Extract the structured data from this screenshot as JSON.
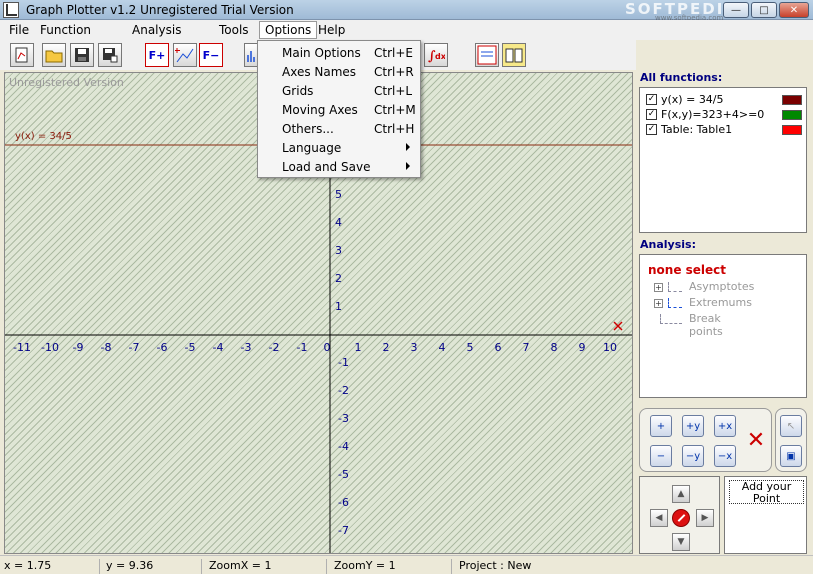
{
  "window": {
    "title": "Graph Plotter v1.2  Unregistered Trial Version",
    "watermark": "SOFTPEDIA",
    "watermark_url": "www.softpedia.com",
    "min_glyph": "—",
    "max_glyph": "□",
    "close_glyph": "✕"
  },
  "menubar": {
    "items": [
      "File",
      "Function",
      "Analysis",
      "Tools",
      "Options",
      "Help"
    ]
  },
  "toolbar": {
    "buttons": [
      "new-graph",
      "open",
      "save",
      "save-as",
      "F+",
      "add-point-function",
      "F−",
      "derivative",
      "integral",
      "step-by-step-solution",
      "help-book"
    ]
  },
  "options_menu": {
    "items": [
      {
        "label": "Main Options",
        "shortcut": "Ctrl+E"
      },
      {
        "label": "Axes Names",
        "shortcut": "Ctrl+R"
      },
      {
        "label": "Grids",
        "shortcut": "Ctrl+L"
      },
      {
        "label": "Moving Axes",
        "shortcut": "Ctrl+M"
      },
      {
        "label": "Others...",
        "shortcut": "Ctrl+H"
      },
      {
        "label": "Language",
        "submenu": true
      },
      {
        "label": "Load and Save",
        "submenu": true
      }
    ]
  },
  "graph": {
    "unregistered": "Unregistered Version",
    "function_label": "y(x) = 34/5",
    "x_ticks": [
      "-11",
      "-10",
      "-9",
      "-8",
      "-7",
      "-6",
      "-5",
      "-4",
      "-3",
      "-2",
      "-1",
      "0",
      "1",
      "2",
      "3",
      "4",
      "5",
      "6",
      "7",
      "8",
      "9",
      "10"
    ],
    "y_ticks": [
      "5",
      "4",
      "3",
      "2",
      "1",
      "-1",
      "-2",
      "-3",
      "-4",
      "-5",
      "-6",
      "-7"
    ]
  },
  "functions_panel": {
    "title": "All functions:",
    "items": [
      {
        "label": "y(x) = 34/5",
        "checked": true,
        "color": "#7a0000"
      },
      {
        "label": "F(x,y)=323+4>=0",
        "checked": true,
        "color": "#008800"
      },
      {
        "label": "Table: Table1",
        "checked": true,
        "color": "#ff0000"
      }
    ]
  },
  "analysis_panel": {
    "title": "Analysis:",
    "none_select": "none select",
    "items": [
      "Asymptotes",
      "Extremums",
      "Break points"
    ]
  },
  "add_point": {
    "label": "Add your Point"
  },
  "status": {
    "x": "x = 1.75",
    "y": "y = 9.36",
    "zoom_x": "ZoomX = 1",
    "zoom_y": "ZoomY = 1",
    "project": "Project : New"
  }
}
